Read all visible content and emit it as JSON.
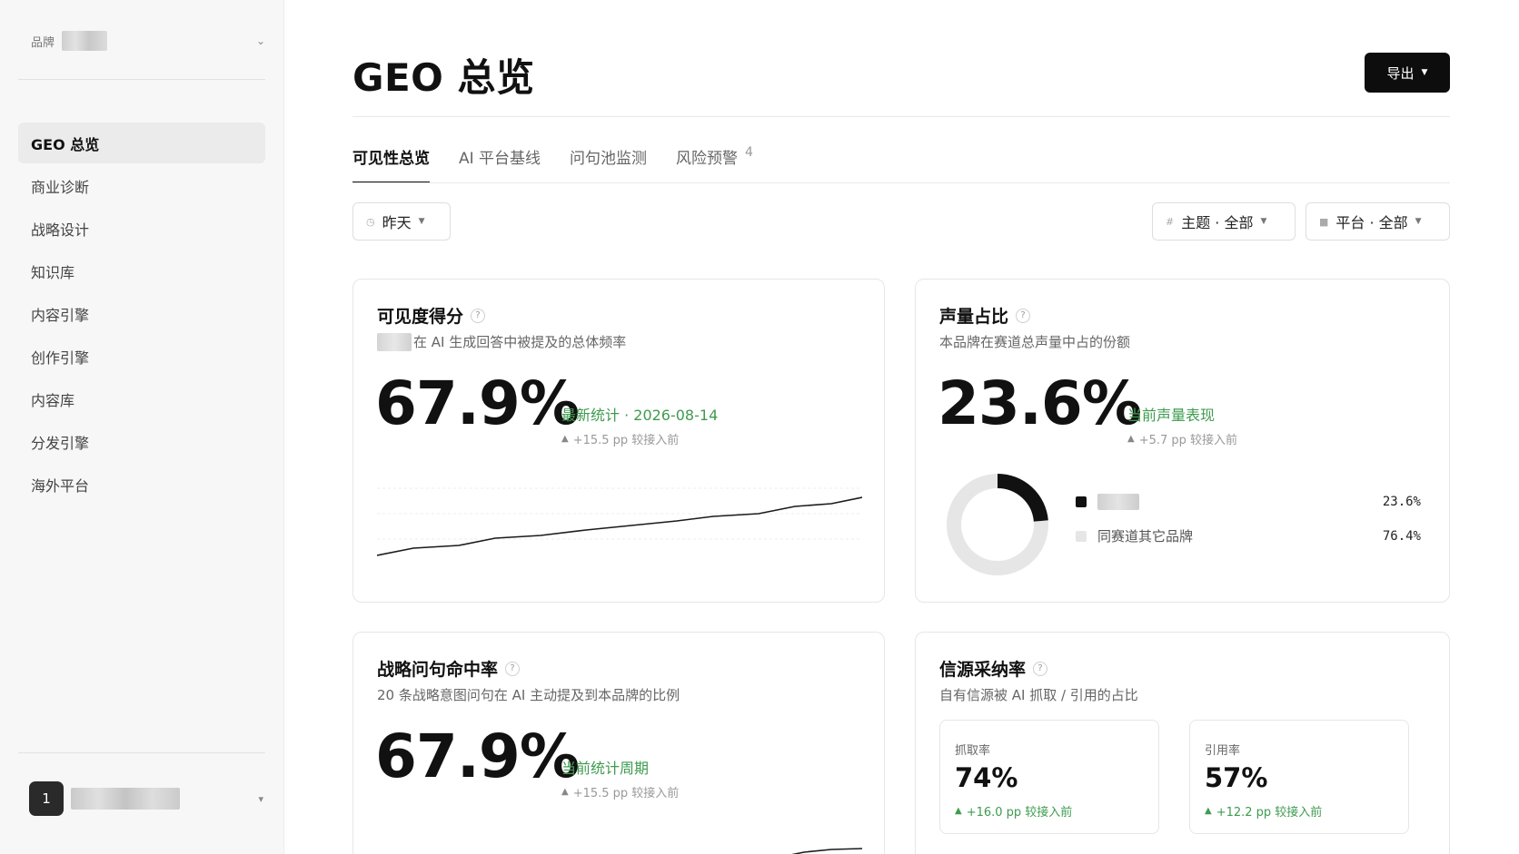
{
  "sidebar": {
    "brand_label": "品牌",
    "nav": [
      {
        "label": "GEO 总览",
        "active": true
      },
      {
        "label": "商业诊断"
      },
      {
        "label": "战略设计"
      },
      {
        "label": "知识库"
      },
      {
        "label": "内容引擎"
      },
      {
        "label": "创作引擎"
      },
      {
        "label": "内容库"
      },
      {
        "label": "分发引擎"
      },
      {
        "label": "海外平台"
      }
    ],
    "user_avatar": "1"
  },
  "header": {
    "title": "GEO 总览",
    "export_label": "导出"
  },
  "tabs": [
    {
      "label": "可见性总览",
      "active": true
    },
    {
      "label": "AI 平台基线"
    },
    {
      "label": "问句池监测"
    },
    {
      "label": "风险预警",
      "badge": "4"
    }
  ],
  "filters": {
    "date": "昨天",
    "topic": "主题 · 全部",
    "platform": "平台 · 全部"
  },
  "cards": {
    "visibility": {
      "title": "可见度得分",
      "subtitle": "在 AI 生成回答中被提及的总体频率",
      "value": "67.9%",
      "status": "最新统计 · 2026-08-14",
      "delta": "+15.5 pp 较接入前"
    },
    "voice_share": {
      "title": "声量占比",
      "subtitle": "本品牌在赛道总声量中占的份额",
      "value": "23.6%",
      "status": "当前声量表现",
      "delta": "+5.7 pp 较接入前",
      "legend": [
        {
          "label": "",
          "value": "23.6%",
          "color": "#111111"
        },
        {
          "label": "同赛道其它品牌",
          "value": "76.4%",
          "color": "#e6e6e6"
        }
      ]
    },
    "strategy_hit": {
      "title": "战略问句命中率",
      "subtitle": "20 条战略意图问句在 AI 主动提及到本品牌的比例",
      "value": "67.9%",
      "status": "当前统计周期",
      "delta": "+15.5 pp 较接入前"
    },
    "source_adoption": {
      "title": "信源采纳率",
      "subtitle": "自有信源被 AI 抓取 / 引用的占比",
      "crawl": {
        "label": "抓取率",
        "value": "74%",
        "delta": "+16.0 pp 较接入前"
      },
      "cite": {
        "label": "引用率",
        "value": "57%",
        "delta": "+12.2 pp 较接入前"
      }
    }
  },
  "colors": {
    "accent_green": "#3e9b4f",
    "primary": "#0d0d0d"
  }
}
